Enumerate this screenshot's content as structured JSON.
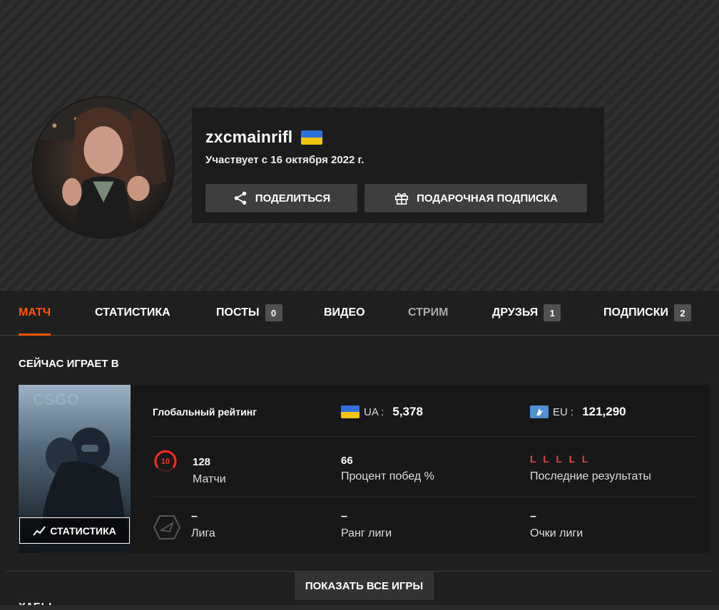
{
  "profile": {
    "nickname": "zxcmainrifl",
    "country_flag": "ukraine-flag",
    "member_since": "Участвует с 16 октября 2022 г.",
    "share_label": "ПОДЕЛИТЬСЯ",
    "gift_label": "ПОДАРОЧНАЯ ПОДПИСКА"
  },
  "tabs": [
    {
      "label": "МАТЧ",
      "active": true
    },
    {
      "label": "СТАТИСТИКА"
    },
    {
      "label": "ПОСТЫ",
      "badge": "0"
    },
    {
      "label": "ВИДЕО"
    },
    {
      "label": "СТРИМ",
      "muted": true
    },
    {
      "label": "ДРУЗЬЯ",
      "badge": "1"
    },
    {
      "label": "ПОДПИСКИ",
      "badge": "2"
    }
  ],
  "now_playing": {
    "title": "СЕЙЧАС ИГРАЕТ В",
    "stats_button": "СТАТИСТИКА",
    "global_rating_label": "Глобальный рейтинг",
    "region_rank": {
      "code": "UA :",
      "value": "5,378"
    },
    "eu_rank": {
      "code": "EU :",
      "value": "121,290"
    },
    "skill_level": "10",
    "matches": {
      "value": "128",
      "label": "Матчи"
    },
    "win_rate": {
      "value": "66",
      "label": "Процент побед %"
    },
    "recent_results": {
      "value": "L L L L L",
      "label": "Последние результаты"
    },
    "league": {
      "value": "–",
      "label": "Лига"
    },
    "league_rank": {
      "value": "–",
      "label": "Ранг лиги"
    },
    "league_points": {
      "value": "–",
      "label": "Очки лиги"
    }
  },
  "show_all_label": "ПОКАЗАТЬ ВСЕ ИГРЫ",
  "next_section_label": "ХАБЫ",
  "colors": {
    "accent": "#ff5500",
    "loss": "#e54545",
    "flag_blue": "#2f6fdc",
    "flag_yellow": "#f4c415"
  }
}
